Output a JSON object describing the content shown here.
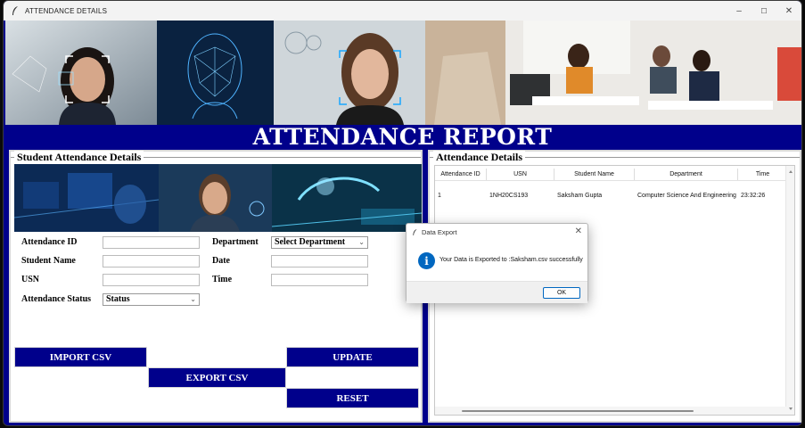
{
  "window": {
    "title": "ATTENDANCE DETAILS",
    "controls": {
      "minimize": "–",
      "maximize": "☐",
      "close": "✕"
    }
  },
  "header": {
    "title": "ATTENDANCE REPORT"
  },
  "left_panel": {
    "legend": "Student Attendance Details",
    "fields": {
      "attendance_id": {
        "label": "Attendance ID",
        "value": ""
      },
      "student_name": {
        "label": "Student Name",
        "value": ""
      },
      "usn": {
        "label": "USN",
        "value": ""
      },
      "attendance_status": {
        "label": "Attendance Status",
        "value": "Status"
      },
      "department": {
        "label": "Department",
        "value": "Select Department"
      },
      "date": {
        "label": "Date",
        "value": ""
      },
      "time": {
        "label": "Time",
        "value": ""
      }
    },
    "buttons": {
      "import": "IMPORT CSV",
      "export": "EXPORT CSV",
      "update": "UPDATE",
      "reset": "RESET"
    }
  },
  "right_panel": {
    "legend": "Attendance Details",
    "columns": [
      "Attendance ID",
      "USN",
      "Student Name",
      "Department",
      "Time"
    ],
    "rows": [
      [
        "1",
        "1NH20CS193",
        "Saksham Gupta",
        "Computer Science And Engineering",
        "23:32:26"
      ]
    ]
  },
  "dialog": {
    "title": "Data Export",
    "message": "Your Data is Exported to :Saksham.csv successfully",
    "icon": "info-icon",
    "ok_label": "OK",
    "close_glyph": "✕"
  },
  "colors": {
    "background": "#00008b",
    "button": "#00008b",
    "title_text": "#ffffff",
    "info_icon": "#0067c0"
  }
}
